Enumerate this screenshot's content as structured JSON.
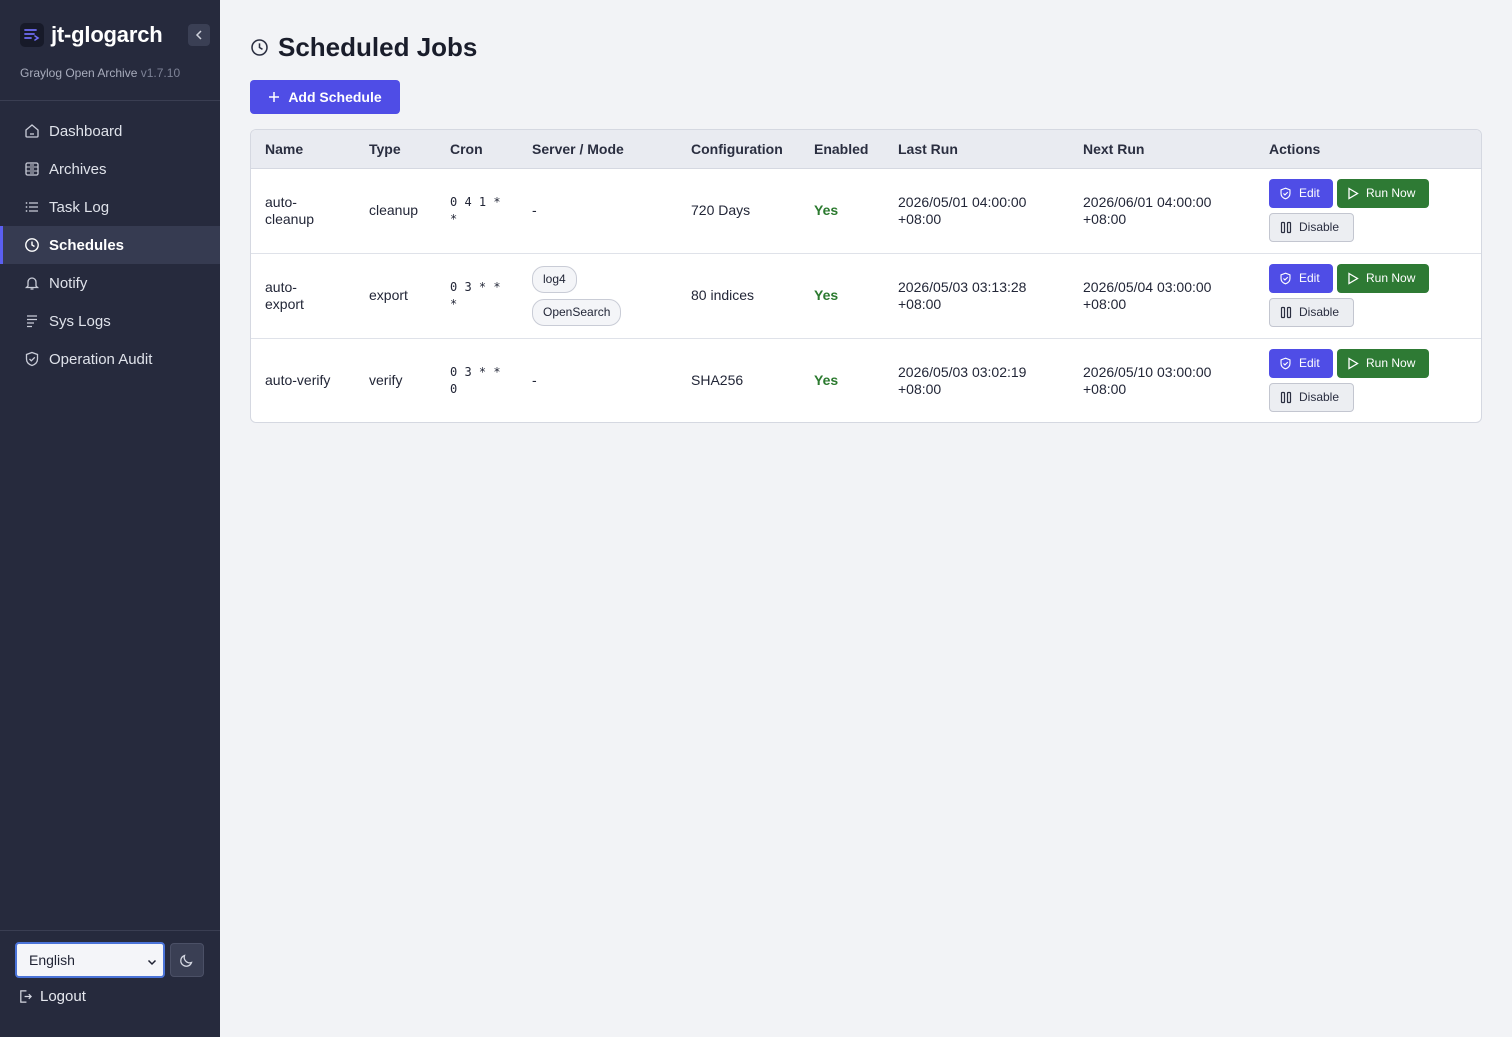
{
  "app": {
    "name": "jt-glogarch",
    "subtitle": "Graylog Open Archive",
    "version": "v1.7.10"
  },
  "sidebar": {
    "items": [
      {
        "label": "Dashboard",
        "icon": "home-icon"
      },
      {
        "label": "Archives",
        "icon": "archive-icon"
      },
      {
        "label": "Task Log",
        "icon": "list-icon"
      },
      {
        "label": "Schedules",
        "icon": "clock-icon",
        "active": true
      },
      {
        "label": "Notify",
        "icon": "bell-icon"
      },
      {
        "label": "Sys Logs",
        "icon": "lines-icon"
      },
      {
        "label": "Operation Audit",
        "icon": "shield-icon"
      }
    ],
    "language": "English",
    "logout_label": "Logout"
  },
  "page": {
    "title": "Scheduled Jobs",
    "add_label": "Add Schedule"
  },
  "table": {
    "headers": [
      "Name",
      "Type",
      "Cron",
      "Server / Mode",
      "Configuration",
      "Enabled",
      "Last Run",
      "Next Run",
      "Actions"
    ],
    "rows": [
      {
        "name": "auto-cleanup",
        "type": "cleanup",
        "cron": "0 4 1 * *",
        "server": "-",
        "tags": [],
        "config": "720 Days",
        "enabled": "Yes",
        "last_run": "2026/05/01 04:00:00 +08:00",
        "next_run": "2026/06/01 04:00:00 +08:00"
      },
      {
        "name": "auto-export",
        "type": "export",
        "cron": "0 3 * * *",
        "server": "",
        "tags": [
          "log4",
          "OpenSearch"
        ],
        "config": "80 indices",
        "enabled": "Yes",
        "last_run": "2026/05/03 03:13:28 +08:00",
        "next_run": "2026/05/04 03:00:00 +08:00"
      },
      {
        "name": "auto-verify",
        "type": "verify",
        "cron": "0 3 * * 0",
        "server": "-",
        "tags": [],
        "config": "SHA256",
        "enabled": "Yes",
        "last_run": "2026/05/03 03:02:19 +08:00",
        "next_run": "2026/05/10 03:00:00 +08:00"
      }
    ],
    "actions": {
      "edit_label": "Edit",
      "run_label": "Run Now",
      "disable_label": "Disable"
    }
  },
  "colors": {
    "sidebar_bg": "#262a3d",
    "accent": "#4f4de6",
    "run_green": "#2e7a34",
    "enabled_green": "#2b7a2f"
  }
}
